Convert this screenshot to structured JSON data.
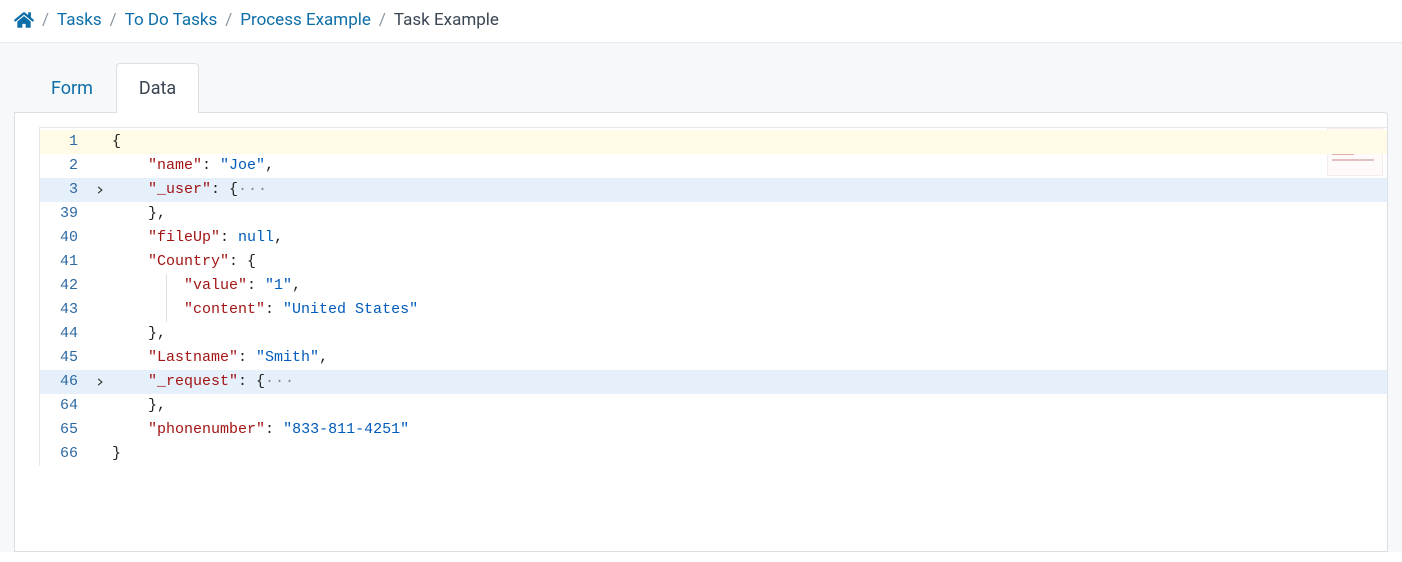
{
  "breadcrumb": {
    "items": [
      {
        "label": "Tasks"
      },
      {
        "label": "To Do Tasks"
      },
      {
        "label": "Process Example"
      }
    ],
    "current": "Task Example"
  },
  "tabs": {
    "form_label": "Form",
    "data_label": "Data"
  },
  "editor": {
    "highlighted_lines": [
      3,
      46
    ],
    "cursor_line": 1,
    "lines": [
      {
        "num": "1",
        "fold": "",
        "tokens": [
          {
            "c": "tok-punct",
            "t": "{"
          }
        ]
      },
      {
        "num": "2",
        "fold": "",
        "tokens": [
          {
            "c": "",
            "t": "    "
          },
          {
            "c": "tok-prop",
            "t": "\"name\""
          },
          {
            "c": "tok-punct",
            "t": ": "
          },
          {
            "c": "tok-str",
            "t": "\"Joe\""
          },
          {
            "c": "tok-punct",
            "t": ","
          }
        ]
      },
      {
        "num": "3",
        "fold": "closed",
        "tokens": [
          {
            "c": "",
            "t": "    "
          },
          {
            "c": "tok-prop",
            "t": "\"_user\""
          },
          {
            "c": "tok-punct",
            "t": ": {"
          },
          {
            "c": "tok-ell",
            "t": "···"
          }
        ]
      },
      {
        "num": "39",
        "fold": "",
        "tokens": [
          {
            "c": "",
            "t": "    "
          },
          {
            "c": "tok-punct",
            "t": "},"
          }
        ]
      },
      {
        "num": "40",
        "fold": "",
        "tokens": [
          {
            "c": "",
            "t": "    "
          },
          {
            "c": "tok-prop",
            "t": "\"fileUp\""
          },
          {
            "c": "tok-punct",
            "t": ": "
          },
          {
            "c": "tok-null",
            "t": "null"
          },
          {
            "c": "tok-punct",
            "t": ","
          }
        ]
      },
      {
        "num": "41",
        "fold": "",
        "tokens": [
          {
            "c": "",
            "t": "    "
          },
          {
            "c": "tok-prop",
            "t": "\"Country\""
          },
          {
            "c": "tok-punct",
            "t": ": {"
          }
        ]
      },
      {
        "num": "42",
        "fold": "",
        "tokens": [
          {
            "c": "",
            "t": "        "
          },
          {
            "c": "tok-prop",
            "t": "\"value\""
          },
          {
            "c": "tok-punct",
            "t": ": "
          },
          {
            "c": "tok-str",
            "t": "\"1\""
          },
          {
            "c": "tok-punct",
            "t": ","
          }
        ]
      },
      {
        "num": "43",
        "fold": "",
        "tokens": [
          {
            "c": "",
            "t": "        "
          },
          {
            "c": "tok-prop",
            "t": "\"content\""
          },
          {
            "c": "tok-punct",
            "t": ": "
          },
          {
            "c": "tok-str",
            "t": "\"United States\""
          }
        ]
      },
      {
        "num": "44",
        "fold": "",
        "tokens": [
          {
            "c": "",
            "t": "    "
          },
          {
            "c": "tok-punct",
            "t": "},"
          }
        ]
      },
      {
        "num": "45",
        "fold": "",
        "tokens": [
          {
            "c": "",
            "t": "    "
          },
          {
            "c": "tok-prop",
            "t": "\"Lastname\""
          },
          {
            "c": "tok-punct",
            "t": ": "
          },
          {
            "c": "tok-str",
            "t": "\"Smith\""
          },
          {
            "c": "tok-punct",
            "t": ","
          }
        ]
      },
      {
        "num": "46",
        "fold": "closed",
        "tokens": [
          {
            "c": "",
            "t": "    "
          },
          {
            "c": "tok-prop",
            "t": "\"_request\""
          },
          {
            "c": "tok-punct",
            "t": ": {"
          },
          {
            "c": "tok-ell",
            "t": "···"
          }
        ]
      },
      {
        "num": "64",
        "fold": "",
        "tokens": [
          {
            "c": "",
            "t": "    "
          },
          {
            "c": "tok-punct",
            "t": "},"
          }
        ]
      },
      {
        "num": "65",
        "fold": "",
        "tokens": [
          {
            "c": "",
            "t": "    "
          },
          {
            "c": "tok-prop",
            "t": "\"phonenumber\""
          },
          {
            "c": "tok-punct",
            "t": ": "
          },
          {
            "c": "tok-str",
            "t": "\"833-811-4251\""
          }
        ]
      },
      {
        "num": "66",
        "fold": "",
        "tokens": [
          {
            "c": "tok-punct",
            "t": "}"
          }
        ]
      }
    ]
  }
}
